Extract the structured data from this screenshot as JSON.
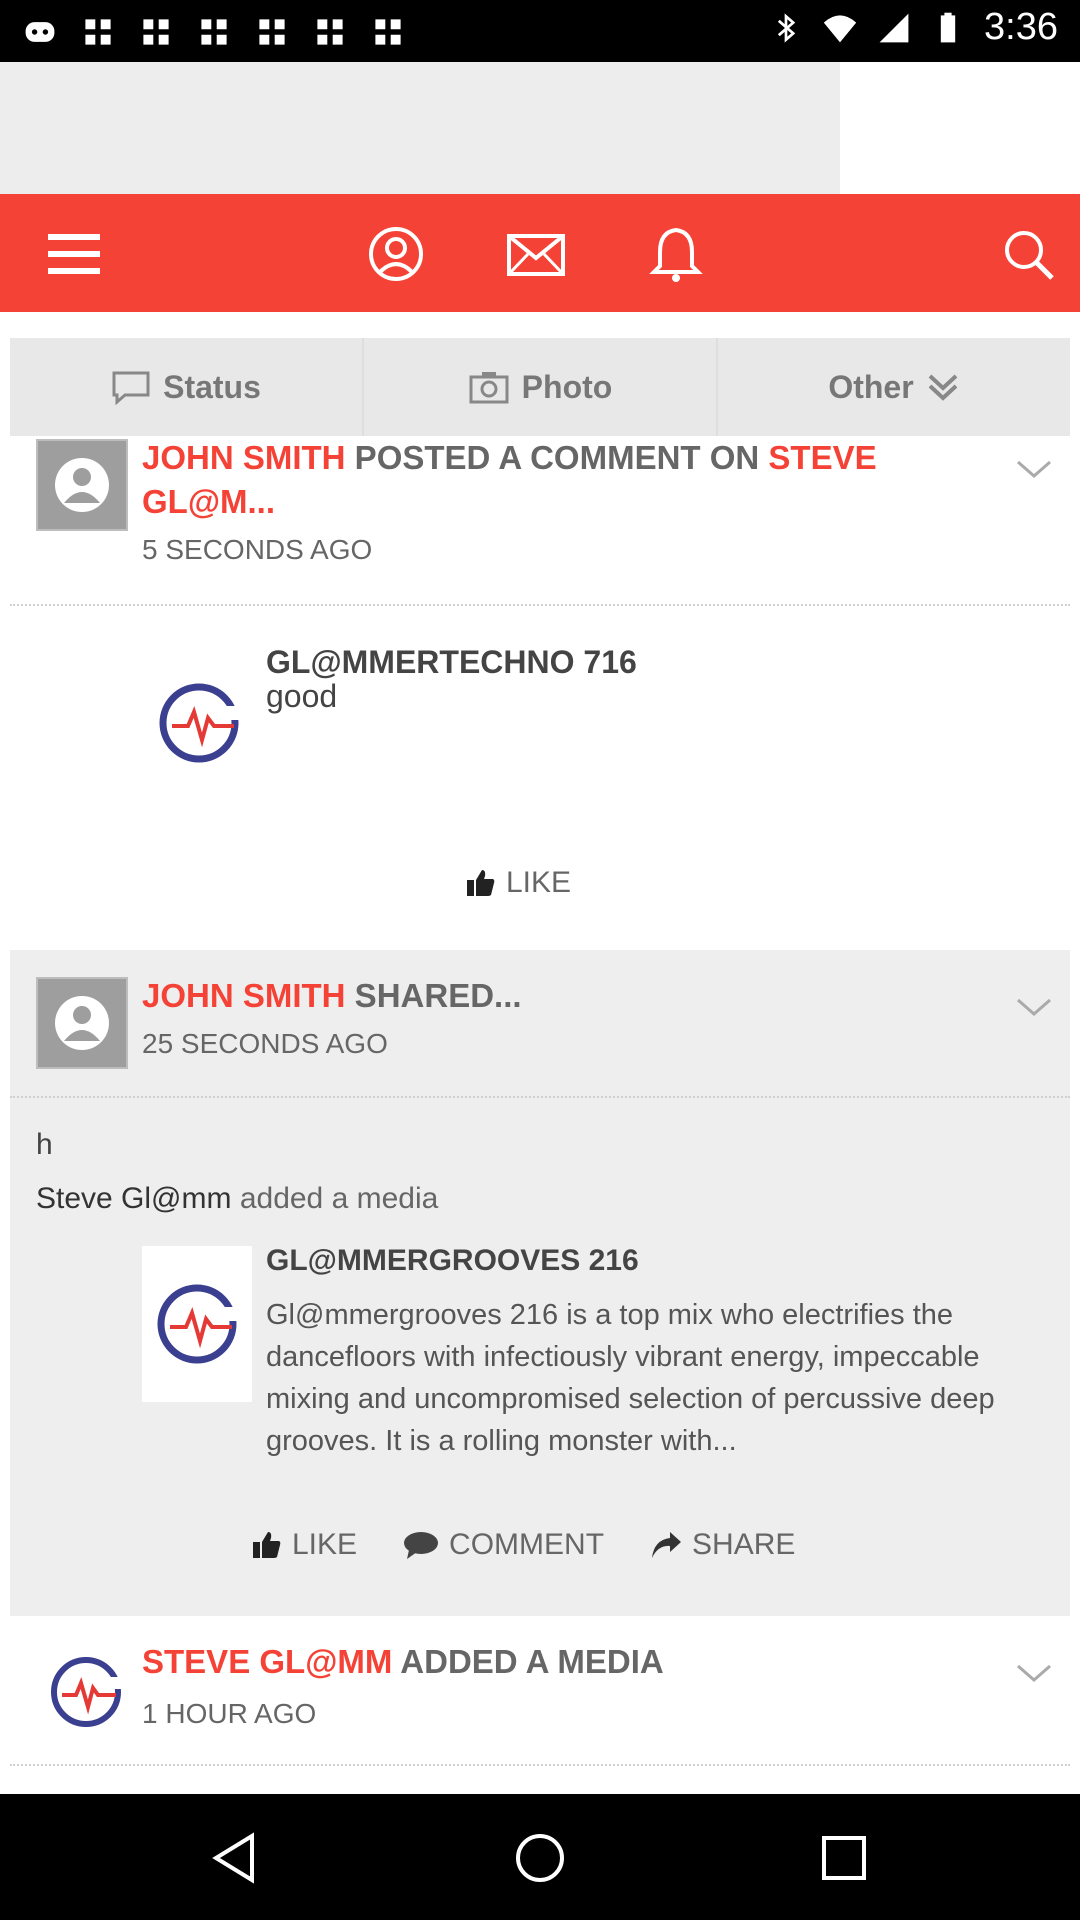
{
  "status_bar": {
    "time": "3:36",
    "icons": [
      "discord-icon",
      "grid-icon",
      "grid-icon",
      "grid-icon",
      "grid-icon",
      "grid-icon",
      "grid-icon",
      "bluetooth-icon",
      "wifi-icon",
      "signal-icon",
      "battery-icon"
    ]
  },
  "toolbar": {
    "icons": [
      "menu-icon",
      "profile-icon",
      "mail-icon",
      "bell-icon",
      "search-icon"
    ],
    "color": "#f44336"
  },
  "tabs": [
    {
      "label": "Status",
      "icon": "chat-bubble-icon"
    },
    {
      "label": "Photo",
      "icon": "camera-icon"
    },
    {
      "label": "Other",
      "icon": "double-chevron-down-icon"
    }
  ],
  "feed": [
    {
      "actor": "JOHN SMITH",
      "verb": " POSTED A COMMENT ON ",
      "target": "STEVE GL@M...",
      "time": "5 SECONDS AGO",
      "post_title": "GL@MMERTECHNO 716",
      "post_text": "good",
      "like_label": "LIKE"
    },
    {
      "actor": "JOHN SMITH",
      "verb": " SHARED...",
      "time": "25 SECONDS AGO",
      "body_line1": "h",
      "body_line2_name": "Steve Gl@mm",
      "body_line2_rest": " added a media",
      "media_title": "GL@MMERGROOVES 216",
      "media_desc": "Gl@mmergrooves 216 is a top mix who electrifies the dancefloors with infectiously vibrant energy, impeccable mixing and uncompromised selection of percussive deep grooves. It is a rolling monster with...",
      "like_label": "LIKE",
      "comment_label": "COMMENT",
      "share_label": "SHARE"
    },
    {
      "actor": "STEVE GL@MM",
      "verb": " ADDED A MEDIA",
      "time": "1 HOUR AGO"
    }
  ],
  "nav": [
    "back-icon",
    "home-icon",
    "recents-icon"
  ]
}
